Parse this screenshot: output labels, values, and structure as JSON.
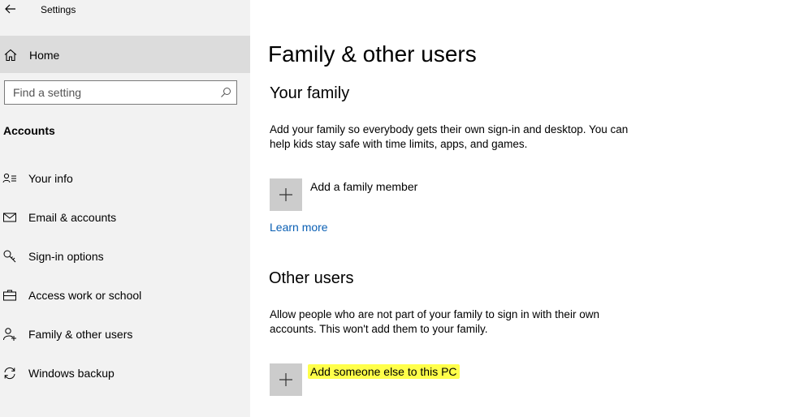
{
  "window": {
    "title": "Settings"
  },
  "sidebar": {
    "home_label": "Home",
    "search_placeholder": "Find a setting",
    "section_title": "Accounts",
    "items": [
      {
        "label": "Your info",
        "icon": "person-card-icon"
      },
      {
        "label": "Email & accounts",
        "icon": "mail-icon"
      },
      {
        "label": "Sign-in options",
        "icon": "key-icon"
      },
      {
        "label": "Access work or school",
        "icon": "briefcase-icon"
      },
      {
        "label": "Family & other users",
        "icon": "person-add-icon"
      },
      {
        "label": "Windows backup",
        "icon": "sync-icon"
      }
    ]
  },
  "main": {
    "title": "Family & other users",
    "family": {
      "heading": "Your family",
      "description": "Add your family so everybody gets their own sign-in and desktop. You can help kids stay safe with time limits, apps, and games.",
      "add_label": "Add a family member",
      "learn_more": "Learn more"
    },
    "other_users": {
      "heading": "Other users",
      "description": "Allow people who are not part of your family to sign in with their own accounts. This won't add them to your family.",
      "add_label": "Add someone else to this PC"
    }
  },
  "colors": {
    "sidebar_bg": "#f2f2f2",
    "selected_bg": "#dcdcdc",
    "link": "#0a5fb4",
    "highlight": "#ffff4a",
    "plus_tile": "#cccccc"
  }
}
